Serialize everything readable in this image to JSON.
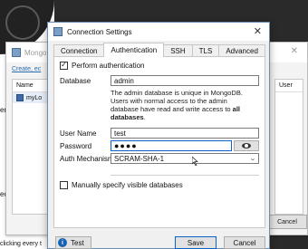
{
  "background": {
    "left_texts": [
      "er",
      "ec",
      "clicking every t"
    ]
  },
  "parent_window": {
    "title": "Mongo",
    "links": "Create, ec",
    "left_table": {
      "header": "Name",
      "rows": [
        {
          "label": "myLo"
        }
      ]
    },
    "right_table": {
      "header": "User"
    },
    "cancel_label": "Cancel"
  },
  "dialog": {
    "title": "Connection Settings",
    "tabs": [
      {
        "label": "Connection",
        "active": false
      },
      {
        "label": "Authentication",
        "active": true
      },
      {
        "label": "SSH",
        "active": false
      },
      {
        "label": "TLS",
        "active": false
      },
      {
        "label": "Advanced",
        "active": false
      }
    ],
    "perform_auth": {
      "label": "Perform authentication",
      "checked": true
    },
    "database": {
      "label": "Database",
      "value": "admin",
      "description_pre": "The admin database is unique in MongoDB. Users with normal access to the admin database have read and write access to ",
      "description_bold": "all databases",
      "description_post": "."
    },
    "username": {
      "label": "User Name",
      "value": "test"
    },
    "password": {
      "label": "Password",
      "value": "●●●●"
    },
    "auth_mechanism": {
      "label": "Auth Mechanism",
      "value": "SCRAM-SHA-1"
    },
    "manual_dbs": {
      "label": "Manually specify visible databases",
      "checked": false
    },
    "buttons": {
      "test": "Test",
      "save": "Save",
      "cancel": "Cancel"
    },
    "colors": {
      "accent": "#0a64c8",
      "info": "#1763b3"
    }
  }
}
